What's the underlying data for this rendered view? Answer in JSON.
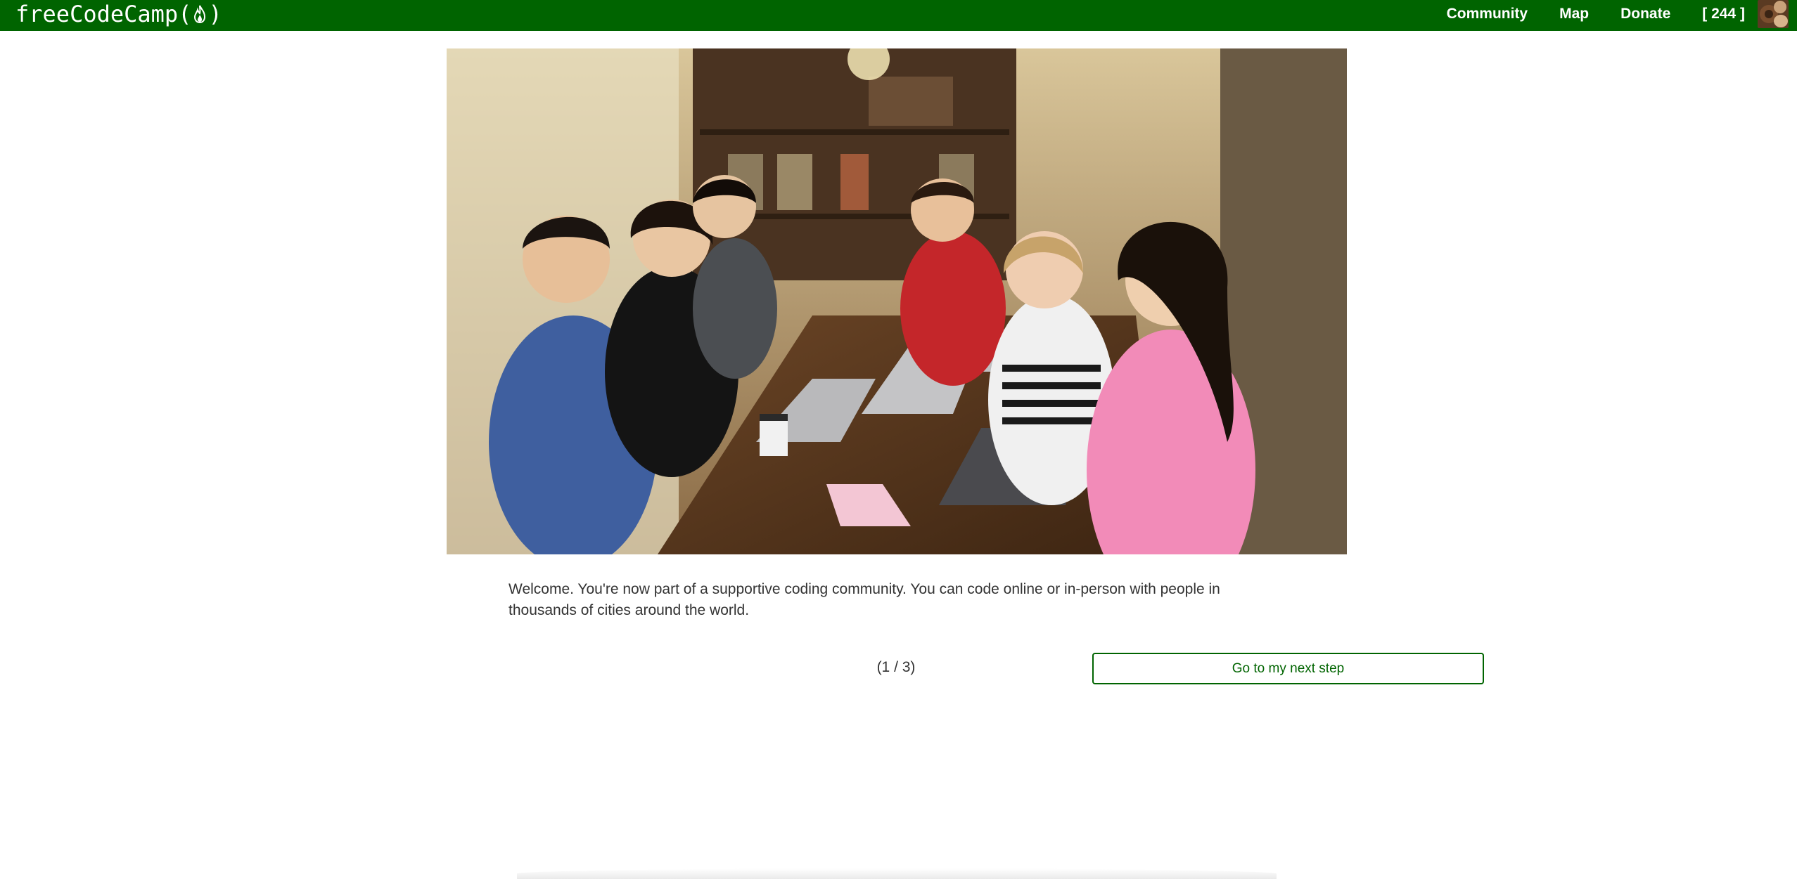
{
  "navbar": {
    "brand_prefix": "freeCodeCamp(",
    "brand_suffix": ")",
    "brand_icon": "flame-icon",
    "background_color": "#006400",
    "links": [
      {
        "label": "Community"
      },
      {
        "label": "Map"
      },
      {
        "label": "Donate"
      }
    ],
    "points": "[ 244 ]",
    "avatar_icon": "user-avatar"
  },
  "main": {
    "image_icon": "group-photo",
    "welcome_text": "Welcome. You're now part of a supportive coding community. You can code online or in-person with people in thousands of cities around the world.",
    "step_counter": "(1 / 3)",
    "next_button_label": "Go to my next step",
    "accent_color": "#006400"
  }
}
